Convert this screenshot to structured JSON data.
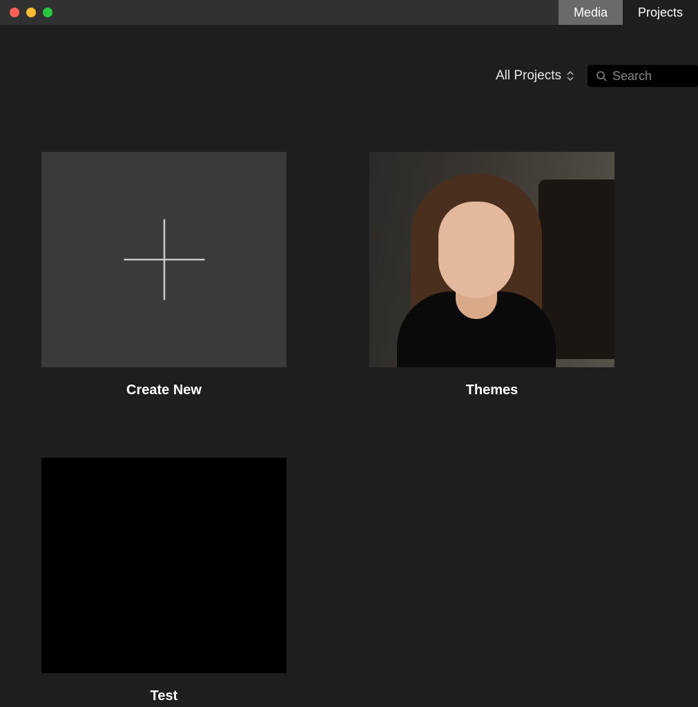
{
  "titlebar": {
    "tabs": [
      {
        "label": "Media",
        "active": true
      },
      {
        "label": "Projects",
        "active": false
      }
    ]
  },
  "toolbar": {
    "filter_label": "All Projects",
    "search_placeholder": "Search"
  },
  "projects": [
    {
      "label": "Create New",
      "kind": "create"
    },
    {
      "label": "Themes",
      "kind": "photo"
    },
    {
      "label": "Test",
      "kind": "black"
    }
  ]
}
